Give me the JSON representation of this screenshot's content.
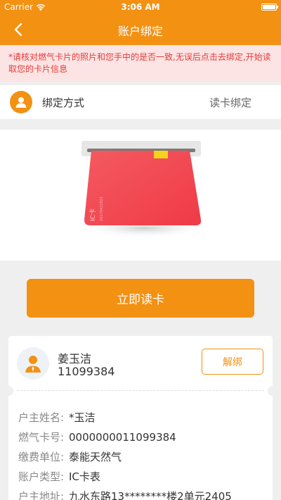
{
  "status_bar": {
    "carrier": "Carrier",
    "time": "3:06 AM"
  },
  "nav": {
    "title": "账户绑定"
  },
  "notice": {
    "text": "*请核对燃气卡片的照片和您手中的是否一致,无误后点击去绑定,开始读取您的卡片信息"
  },
  "bind_method": {
    "label": "绑定方式",
    "value": "读卡绑定"
  },
  "card_image": {
    "card_label": "IC卡",
    "card_number": "20170422921"
  },
  "read_button": {
    "label": "立即读卡"
  },
  "account": {
    "name": "姜玉洁",
    "id": "11099384",
    "unbind_label": "解绑",
    "rows": [
      {
        "key": "户主姓名:",
        "value": "*玉洁"
      },
      {
        "key": "燃气卡号:",
        "value": "0000000011099384"
      },
      {
        "key": "缴费单位:",
        "value": "泰能天然气"
      },
      {
        "key": "账户类型:",
        "value": "IC卡表"
      },
      {
        "key": "户主地址:",
        "value": "九水东路13********楼2单元2405"
      }
    ]
  },
  "colors": {
    "accent": "#f39113",
    "notice_bg": "#fde4e4",
    "notice_text": "#e53b3b",
    "card_red": "#f24b55"
  }
}
